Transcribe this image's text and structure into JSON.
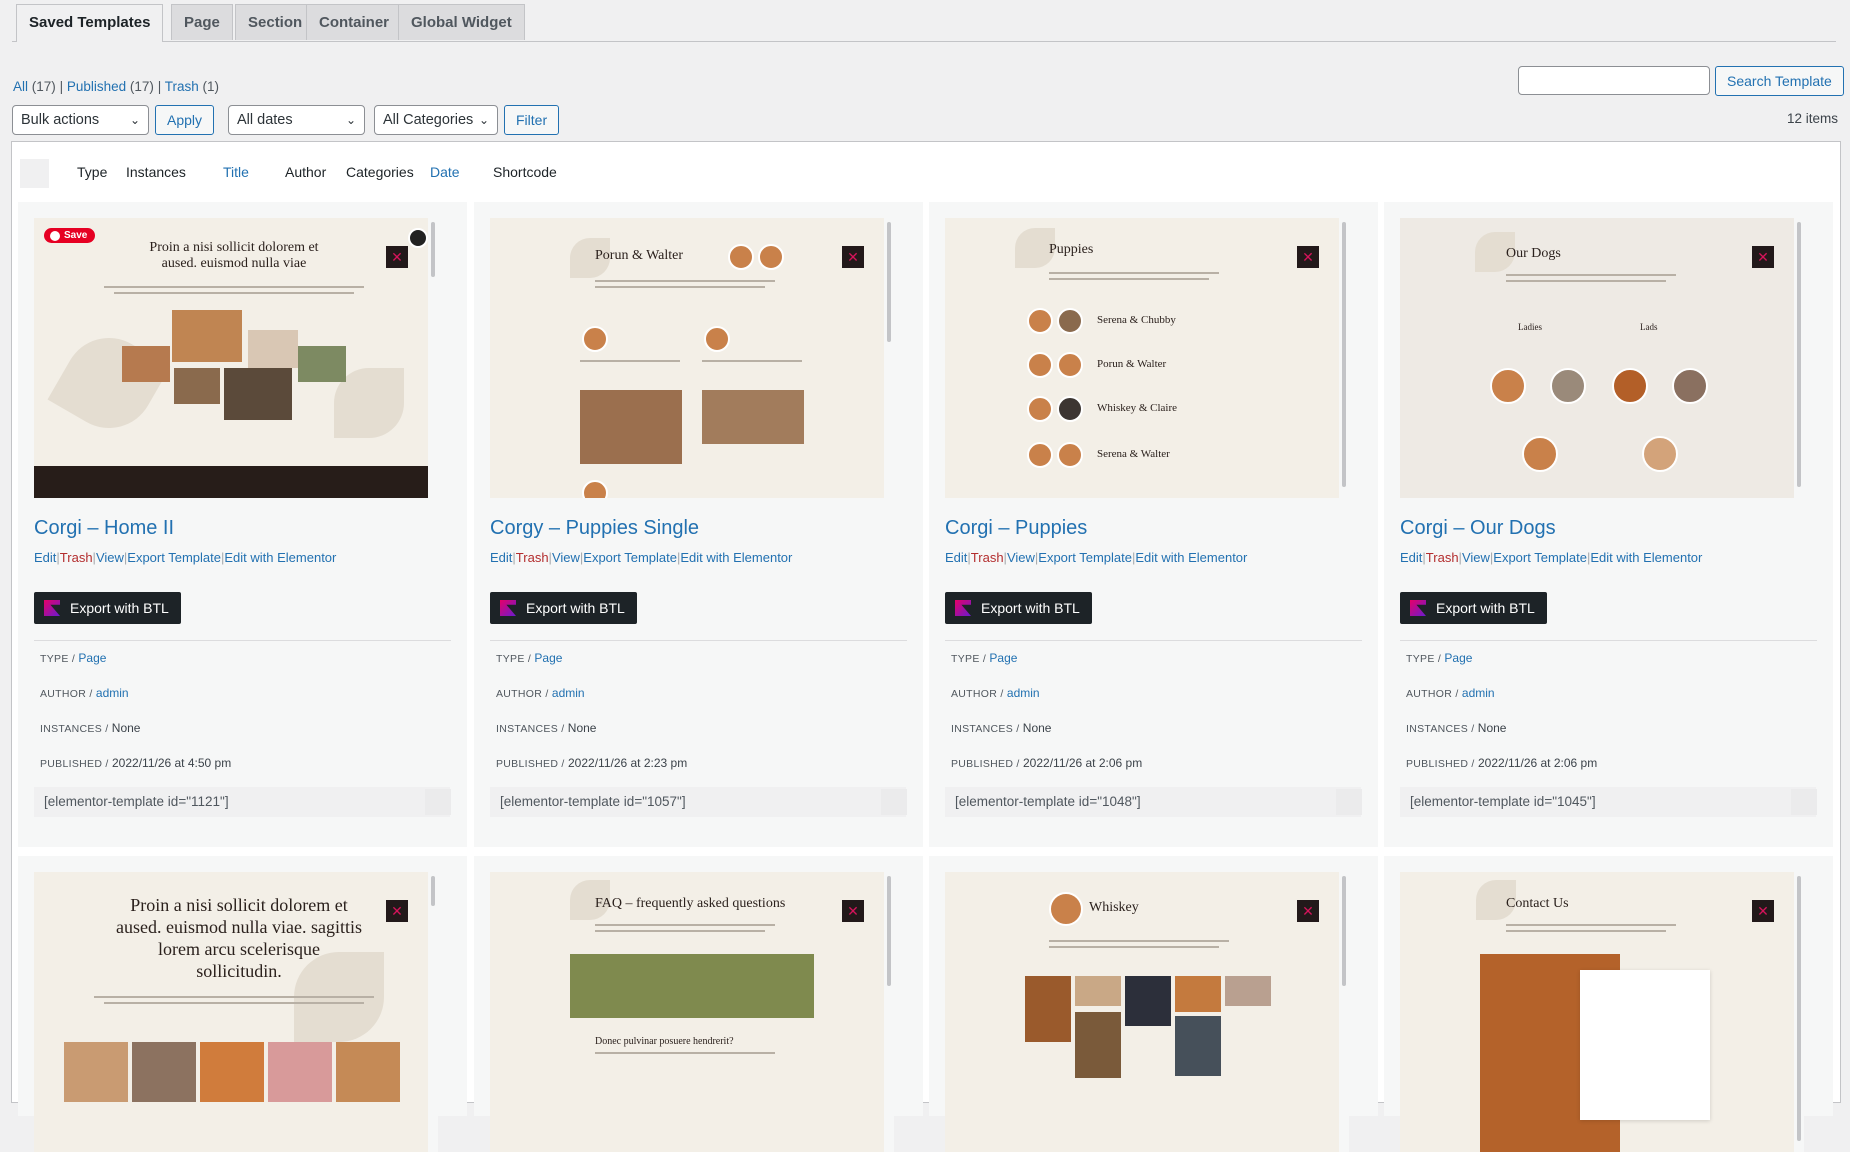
{
  "tabs": [
    {
      "label": "Saved Templates",
      "active": true
    },
    {
      "label": "Page",
      "active": false
    },
    {
      "label": "Section",
      "active": false
    },
    {
      "label": "Container",
      "active": false
    },
    {
      "label": "Global Widget",
      "active": false
    }
  ],
  "views": {
    "all": "All",
    "all_count": "(17)",
    "published": "Published",
    "published_count": "(17)",
    "trash": "Trash",
    "trash_count": "(1)",
    "sep": "|"
  },
  "search": {
    "placeholder": "",
    "button": "Search Template"
  },
  "filters": {
    "bulk_actions": "Bulk actions",
    "apply": "Apply",
    "dates": "All dates",
    "categories": "All Categories",
    "filter": "Filter"
  },
  "items_count": "12 items",
  "sort_columns": {
    "type": "Type",
    "instances": "Instances",
    "title": "Title",
    "author": "Author",
    "categories": "Categories",
    "date": "Date",
    "shortcode": "Shortcode"
  },
  "action_labels": {
    "edit": "Edit",
    "trash": "Trash",
    "view": "View",
    "export": "Export Template",
    "elementor": "Edit with Elementor",
    "sep": "|"
  },
  "export_btl_label": "Export with BTL",
  "meta_labels": {
    "type": "TYPE /",
    "author": "AUTHOR /",
    "instances": "INSTANCES /",
    "published": "PUBLISHED /"
  },
  "pin_label": "Save",
  "cards": [
    {
      "title": "Corgi – Home II",
      "thumb_heading": "Proin a nisi sollicit dolorem et aused. euismod nulla viae",
      "type": "Page",
      "author": "admin",
      "instances": "None",
      "published": "2022/11/26 at 4:50 pm",
      "shortcode": "[elementor-template id=\"1121\"]"
    },
    {
      "title": "Corgy – Puppies Single",
      "thumb_heading": "Porun & Walter",
      "type": "Page",
      "author": "admin",
      "instances": "None",
      "published": "2022/11/26 at 2:23 pm",
      "shortcode": "[elementor-template id=\"1057\"]"
    },
    {
      "title": "Corgi – Puppies",
      "thumb_heading": "Puppies",
      "thumb_rows": [
        "Serena & Chubby",
        "Porun & Walter",
        "Whiskey & Claire",
        "Serena & Walter"
      ],
      "type": "Page",
      "author": "admin",
      "instances": "None",
      "published": "2022/11/26 at 2:06 pm",
      "shortcode": "[elementor-template id=\"1048\"]"
    },
    {
      "title": "Corgi – Our Dogs",
      "thumb_heading": "Our Dogs",
      "thumb_sub": [
        "Ladies",
        "Lads"
      ],
      "type": "Page",
      "author": "admin",
      "instances": "None",
      "published": "2022/11/26 at 2:06 pm",
      "shortcode": "[elementor-template id=\"1045\"]"
    }
  ],
  "cards_row2": [
    {
      "thumb_heading": "Proin a nisi sollicit dolorem et aused. euismod nulla viae. sagittis lorem arcu scelerisque sollicitudin."
    },
    {
      "thumb_heading": "FAQ – frequently asked questions",
      "thumb_sub": "Donec pulvinar posuere hendrerit?"
    },
    {
      "thumb_heading": "Whiskey"
    },
    {
      "thumb_heading": "Contact Us"
    }
  ],
  "colors": {
    "link": "#2271b1",
    "trash": "#b32d2e",
    "btl_bg": "#1d2327",
    "thumb_bg": "#f3efe7"
  }
}
